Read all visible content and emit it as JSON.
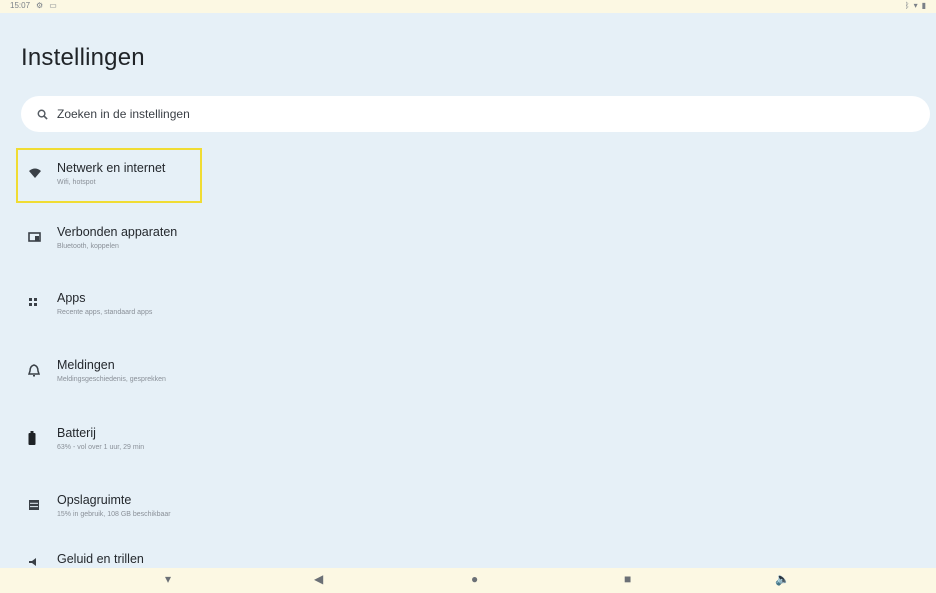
{
  "status_bar": {
    "time": "15:07",
    "left_icons": [
      "settings-small-icon",
      "screen-icon"
    ],
    "right_icons": [
      "bluetooth-icon",
      "wifi-icon",
      "battery-small-icon"
    ]
  },
  "header": {
    "title": "Instellingen"
  },
  "search": {
    "placeholder": "Zoeken in de instellingen"
  },
  "items": [
    {
      "icon": "wifi-icon",
      "label": "Netwerk en internet",
      "sub": "Wifi, hotspot"
    },
    {
      "icon": "devices-icon",
      "label": "Verbonden apparaten",
      "sub": "Bluetooth, koppelen"
    },
    {
      "icon": "apps-icon",
      "label": "Apps",
      "sub": "Recente apps, standaard apps"
    },
    {
      "icon": "bell-icon",
      "label": "Meldingen",
      "sub": "Meldingsgeschiedenis, gesprekken"
    },
    {
      "icon": "battery-icon",
      "label": "Batterij",
      "sub": "63% - vol over 1 uur, 29 min"
    },
    {
      "icon": "storage-icon",
      "label": "Opslagruimte",
      "sub": "15% in gebruik, 108 GB beschikbaar"
    },
    {
      "icon": "sound-icon",
      "label": "Geluid en trillen",
      "sub": ""
    }
  ],
  "nav": [
    "keyboard-icon",
    "back-icon",
    "home-icon",
    "recents-icon",
    "volume-icon"
  ],
  "colors": {
    "background": "#e6f0f7",
    "highlight": "#f0dc33",
    "search_bg": "#ffffff"
  }
}
